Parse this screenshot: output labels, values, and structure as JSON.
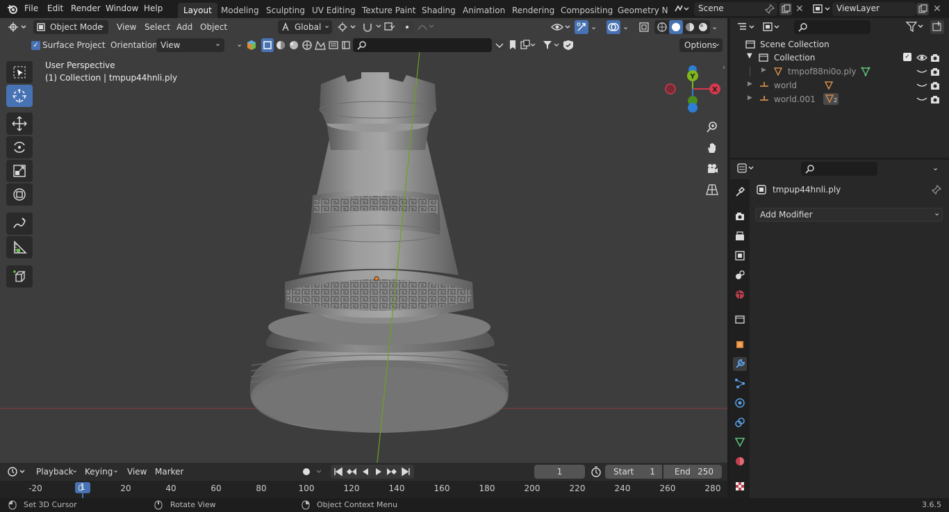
{
  "menu": {
    "file": "File",
    "edit": "Edit",
    "render": "Render",
    "window": "Window",
    "help": "Help"
  },
  "workspaces": [
    "Layout",
    "Modeling",
    "Sculpting",
    "UV Editing",
    "Texture Paint",
    "Shading",
    "Animation",
    "Rendering",
    "Compositing",
    "Geometry Noc"
  ],
  "scene": {
    "name": "Scene",
    "view_layer": "ViewLayer"
  },
  "viewport_header": {
    "mode": "Object Mode",
    "view": "View",
    "select": "Select",
    "add": "Add",
    "object": "Object",
    "transform_orientation": "Global",
    "surface_project": "Surface Project",
    "orientation_label": "Orientation:",
    "orientation_value": "View",
    "options": "Options"
  },
  "viewport": {
    "perspective": "User Perspective",
    "collection_line": "(1) Collection | tmpup44hnli.ply"
  },
  "gizmo": {
    "x": "X",
    "y": "Y",
    "z": "Z"
  },
  "outliner": {
    "scene_collection": "Scene Collection",
    "collection": "Collection",
    "items": [
      {
        "name": "tmpof88ni0o.ply"
      },
      {
        "name": "world"
      },
      {
        "name": "world.001",
        "badge": "2"
      }
    ]
  },
  "properties": {
    "object_name": "tmpup44hnli.ply",
    "add_modifier": "Add Modifier"
  },
  "timeline": {
    "playback": "Playback",
    "keying": "Keying",
    "view": "View",
    "marker": "Marker",
    "current_frame": "1",
    "start_label": "Start",
    "start": "1",
    "end_label": "End",
    "end": "250",
    "ruler": [
      "-20",
      "0",
      "20",
      "40",
      "60",
      "80",
      "100",
      "120",
      "140",
      "160",
      "180",
      "200",
      "220",
      "240",
      "260",
      "280"
    ],
    "cursor_frame": "1"
  },
  "status": {
    "left": "Set 3D Cursor",
    "middle": "Rotate View",
    "right": "Object Context Menu",
    "version": "3.6.5"
  },
  "colors": {
    "accent": "#4772b3",
    "viewport": "#3d3d3d",
    "panel": "#282828",
    "x_axis": "#d6384c",
    "y_axis": "#7fb81d",
    "z_axis": "#2e7ed6"
  }
}
